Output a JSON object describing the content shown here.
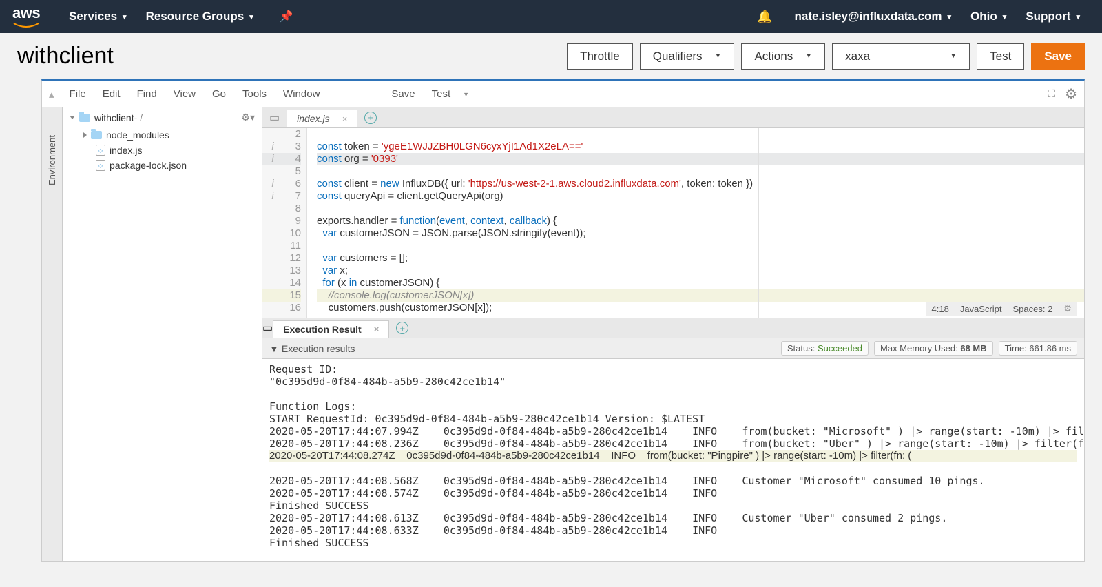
{
  "nav": {
    "logo": "aws",
    "services": "Services",
    "resource_groups": "Resource Groups",
    "user": "nate.isley@influxdata.com",
    "region": "Ohio",
    "support": "Support"
  },
  "function": {
    "name": "withclient",
    "throttle": "Throttle",
    "qualifiers": "Qualifiers",
    "actions": "Actions",
    "test_event_selected": "xaxa",
    "test": "Test",
    "save": "Save"
  },
  "ide": {
    "menus": [
      "File",
      "Edit",
      "Find",
      "View",
      "Go",
      "Tools",
      "Window"
    ],
    "toolbar": {
      "save": "Save",
      "test": "Test"
    },
    "side_label": "Environment",
    "tree": {
      "root": "withclient",
      "root_suffix": " - /",
      "children": [
        "node_modules",
        "index.js",
        "package-lock.json"
      ]
    },
    "tabs": {
      "code": "index.js",
      "results": "Execution Result"
    },
    "code": {
      "lines": [
        {
          "n": 2,
          "info": "",
          "html": ""
        },
        {
          "n": 3,
          "info": "i",
          "html": "<span class='kw'>const</span> token = <span class='str'>'ygeE1WJJZBH0LGN6cyxYjI1Ad1X2eLA=='</span>"
        },
        {
          "n": 4,
          "info": "i",
          "cls": "current",
          "html": "<span class='kw'>const</span> org = <span class='str'>'0393'</span>"
        },
        {
          "n": 5,
          "info": "",
          "html": ""
        },
        {
          "n": 6,
          "info": "i",
          "html": "<span class='kw'>const</span> client = <span class='kw'>new</span> InfluxDB({ url: <span class='str'>'https://us-west-2-1.aws.cloud2.influxdata.com'</span>, token: token })"
        },
        {
          "n": 7,
          "info": "i",
          "html": "<span class='kw'>const</span> queryApi = client.getQueryApi(org)"
        },
        {
          "n": 8,
          "info": "",
          "html": ""
        },
        {
          "n": 9,
          "info": "",
          "html": "exports.handler = <span class='kw'>function</span>(<span class='param'>event</span>, <span class='param'>context</span>, <span class='param'>callback</span>) {"
        },
        {
          "n": 10,
          "info": "",
          "html": "  <span class='kw'>var</span> customerJSON = JSON.parse(JSON.stringify(event));"
        },
        {
          "n": 11,
          "info": "",
          "html": ""
        },
        {
          "n": 12,
          "info": "",
          "html": "  <span class='kw'>var</span> customers = [];"
        },
        {
          "n": 13,
          "info": "",
          "html": "  <span class='kw'>var</span> x;"
        },
        {
          "n": 14,
          "info": "",
          "html": "  <span class='kw'>for</span> (x <span class='kw'>in</span> customerJSON) {"
        },
        {
          "n": 15,
          "info": "",
          "cls": "highlight",
          "html": "    <span class='comment'>//console.log(customerJSON[x])</span>"
        },
        {
          "n": 16,
          "info": "",
          "html": "    customers.push(customerJSON[x]);"
        }
      ],
      "cursor": "4:18",
      "lang": "JavaScript",
      "spaces": "Spaces: 2"
    },
    "results": {
      "header": "Execution results",
      "status_label": "Status:",
      "status_value": "Succeeded",
      "mem_label": "Max Memory Used:",
      "mem_value": "68 MB",
      "time_label": "Time:",
      "time_value": "661.86 ms",
      "log": "Request ID:\n\"0c395d9d-0f84-484b-a5b9-280c42ce1b14\"\n\nFunction Logs:\nSTART RequestId: 0c395d9d-0f84-484b-a5b9-280c42ce1b14 Version: $LATEST\n2020-05-20T17:44:07.994Z    0c395d9d-0f84-484b-a5b9-280c42ce1b14    INFO    from(bucket: \"Microsoft\" ) |> range(start: -10m) |> filter(fn:\n2020-05-20T17:44:08.236Z    0c395d9d-0f84-484b-a5b9-280c42ce1b14    INFO    from(bucket: \"Uber\" ) |> range(start: -10m) |> filter(fn: (r) =\n<HL>2020-05-20T17:44:08.274Z    0c395d9d-0f84-484b-a5b9-280c42ce1b14    INFO    from(bucket: \"Pingpire\" ) |> range(start: -10m) |> filter(fn: (\n2020-05-20T17:44:08.568Z    0c395d9d-0f84-484b-a5b9-280c42ce1b14    INFO    Customer \"Microsoft\" consumed 10 pings.\n2020-05-20T17:44:08.574Z    0c395d9d-0f84-484b-a5b9-280c42ce1b14    INFO\nFinished SUCCESS\n2020-05-20T17:44:08.613Z    0c395d9d-0f84-484b-a5b9-280c42ce1b14    INFO    Customer \"Uber\" consumed 2 pings.\n2020-05-20T17:44:08.633Z    0c395d9d-0f84-484b-a5b9-280c42ce1b14    INFO\nFinished SUCCESS"
    }
  }
}
